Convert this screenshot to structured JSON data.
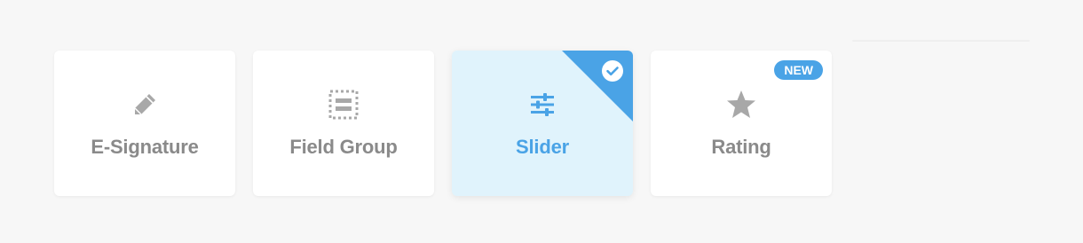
{
  "cards": [
    {
      "label": "E-Signature",
      "icon": "pencil-icon",
      "selected": false
    },
    {
      "label": "Field Group",
      "icon": "field-group-icon",
      "selected": false
    },
    {
      "label": "Slider",
      "icon": "sliders-icon",
      "selected": true
    },
    {
      "label": "Rating",
      "icon": "star-icon",
      "selected": false,
      "badge": "NEW"
    }
  ],
  "colors": {
    "background": "#f7f7f7",
    "card": "#ffffff",
    "selected_card": "#e0f3fc",
    "accent": "#4aa3e6",
    "label": "#8a8a8a",
    "icon": "#a8a8a8"
  }
}
